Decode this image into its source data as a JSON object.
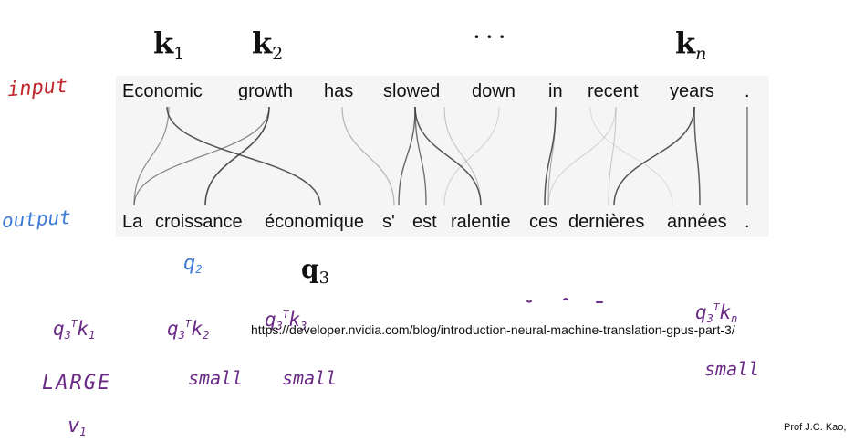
{
  "keys": {
    "k1": {
      "symbol": "k",
      "sub": "1"
    },
    "k2": {
      "symbol": "k",
      "sub": "2"
    },
    "dots": "···",
    "kn": {
      "symbol": "k",
      "sub": "n"
    }
  },
  "handwritten": {
    "input_label": "input",
    "output_label": "output",
    "q2": {
      "text": "q",
      "sub": "2"
    },
    "score1": {
      "q": "q",
      "q_sub": "3",
      "t": "T",
      "k": "k",
      "k_sub": "1"
    },
    "score2": {
      "q": "q",
      "q_sub": "3",
      "t": "T",
      "k": "k",
      "k_sub": "2"
    },
    "score3": {
      "q": "q",
      "q_sub": "3",
      "t": "T",
      "k": "k",
      "k_sub": "3"
    },
    "scoren": {
      "q": "q",
      "q_sub": "3",
      "t": "T",
      "k": "k",
      "k_sub": "n"
    },
    "large": "LARGE",
    "small1": "small",
    "small2": "small",
    "smalln": "small",
    "v1": {
      "text": "v",
      "sub": "1"
    }
  },
  "query": {
    "symbol": "q",
    "sub": "3"
  },
  "input_words": [
    "Economic",
    "growth",
    "has",
    "slowed",
    "down",
    "in",
    "recent",
    "years",
    "."
  ],
  "output_words": [
    "La",
    "croissance",
    "économique",
    "s'",
    "est",
    "ralentie",
    "ces",
    "dernières",
    "années",
    "."
  ],
  "source_url": "https://developer.nvidia.com/blog/introduction-neural-machine-translation-gpus-part-3/",
  "credit": "Prof J.C. Kao,",
  "colors": {
    "red_ink": "#c0282d",
    "blue_ink": "#3d7ad6",
    "purple_ink": "#6b2a86",
    "line_dark": "#3a3a3a",
    "panel_bg": "#f5f5f5"
  }
}
